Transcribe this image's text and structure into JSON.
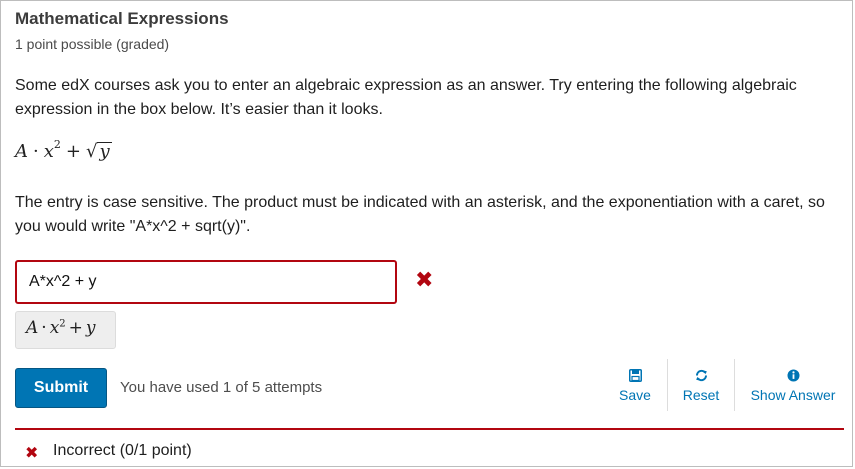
{
  "problem": {
    "title": "Mathematical Expressions",
    "subtitle": "1 point possible (graded)",
    "intro": "Some edX courses ask you to enter an algebraic expression as an answer. Try entering the following algebraic expression in the box below. It’s easier than it looks.",
    "instructions": "The entry is case sensitive. The product must be indicated with an asterisk, and the exponentiation with a caret, so you would write \"A*x^2 + sqrt(y)\"."
  },
  "formula": {
    "A": "A",
    "dot": "·",
    "x": "x",
    "exp": "2",
    "plus": "+",
    "radical": "√",
    "y": "y"
  },
  "answer": {
    "value": "A*x^2 + y",
    "status_icon": "incorrect-x-icon",
    "status_color": "#b20610"
  },
  "preview": {
    "A": "A",
    "dot": "·",
    "x": "x",
    "exp": "2",
    "plus": "+",
    "y": "y"
  },
  "actions": {
    "submit_label": "Submit",
    "attempts_text": "You have used 1 of 5 attempts",
    "save_label": "Save",
    "reset_label": "Reset",
    "show_answer_label": "Show Answer",
    "save_icon": "floppy-disk-icon",
    "reset_icon": "refresh-icon",
    "show_answer_icon": "info-icon"
  },
  "result": {
    "text": "Incorrect (0/1 point)",
    "icon": "incorrect-x-icon"
  },
  "colors": {
    "accent": "#0075b4",
    "error": "#b20610"
  }
}
